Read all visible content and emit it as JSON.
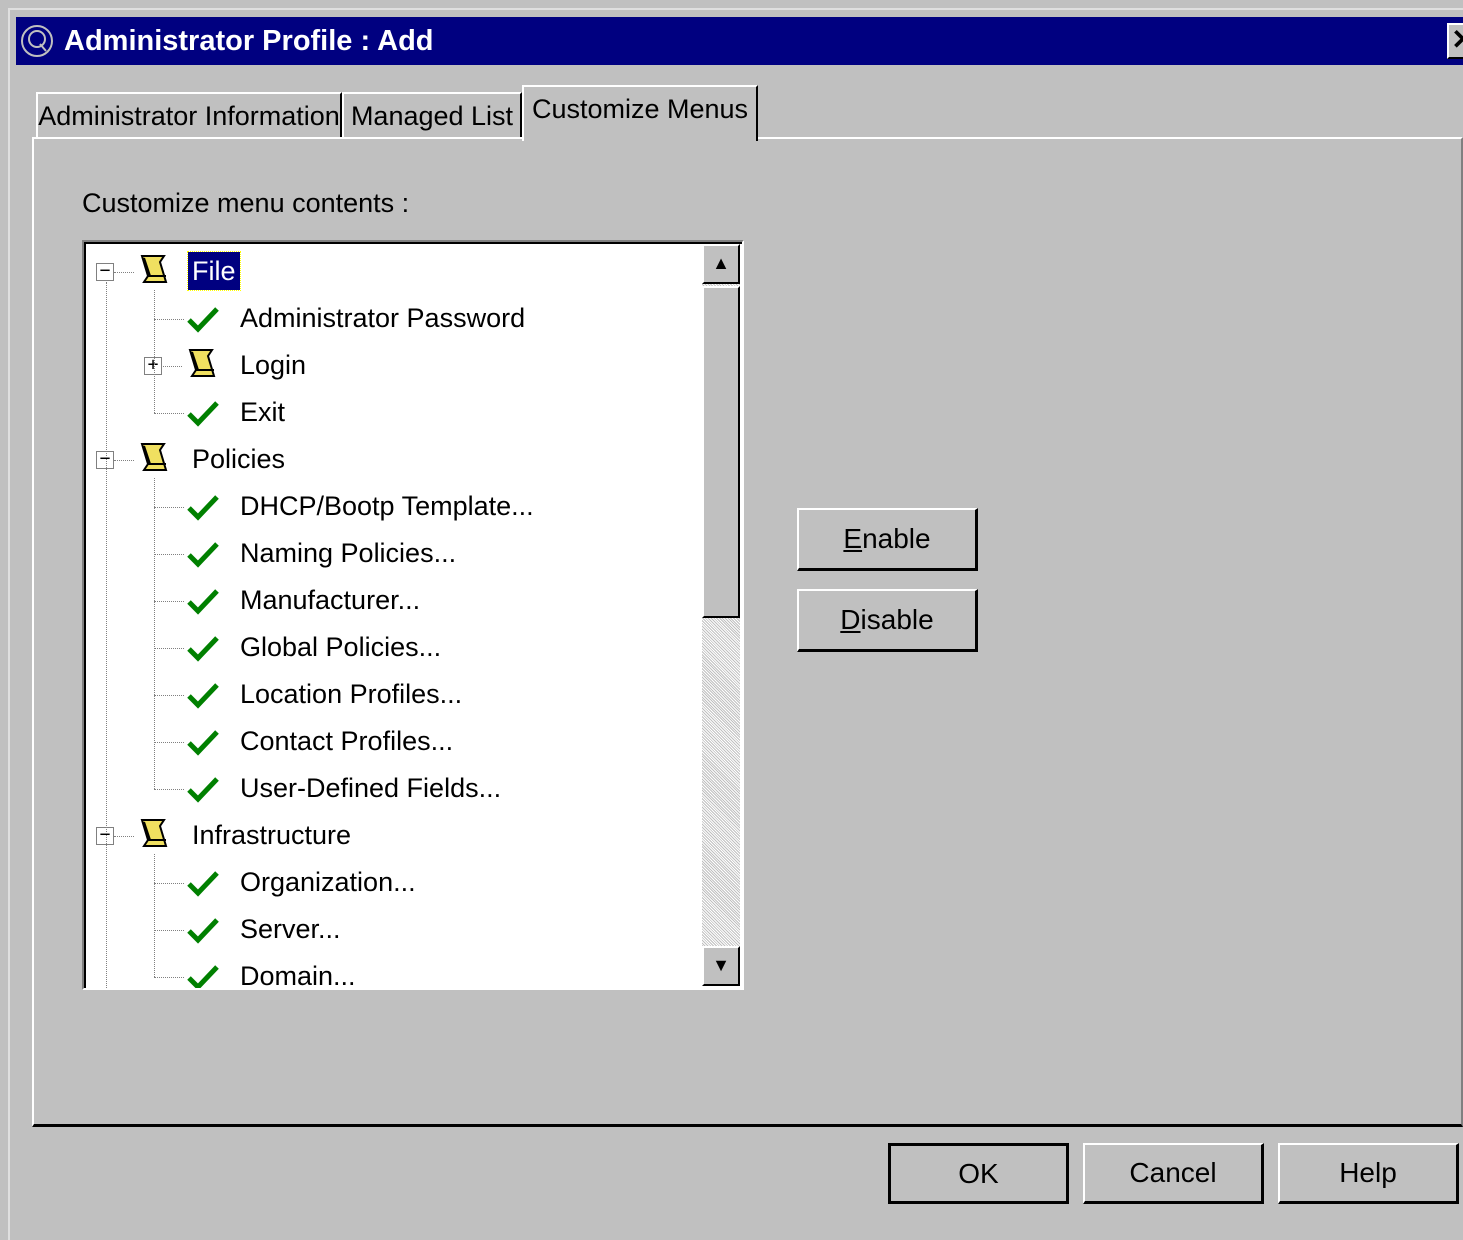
{
  "window": {
    "title": "Administrator Profile : Add",
    "close_label": "✕"
  },
  "tabs": [
    {
      "label": "Administrator Information",
      "active": false
    },
    {
      "label": "Managed List",
      "active": false
    },
    {
      "label": "Customize Menus",
      "active": true
    }
  ],
  "panel": {
    "label": "Customize menu contents :"
  },
  "tree": {
    "nodes": [
      {
        "label": "File",
        "type": "folder",
        "expanded": true,
        "selected": true
      },
      {
        "label": "Administrator Password",
        "type": "item",
        "enabled": true
      },
      {
        "label": "Login",
        "type": "folder",
        "expanded": false
      },
      {
        "label": "Exit",
        "type": "item",
        "enabled": true
      },
      {
        "label": "Policies",
        "type": "folder",
        "expanded": true
      },
      {
        "label": "DHCP/Bootp Template...",
        "type": "item",
        "enabled": true
      },
      {
        "label": "Naming Policies...",
        "type": "item",
        "enabled": true
      },
      {
        "label": "Manufacturer...",
        "type": "item",
        "enabled": true
      },
      {
        "label": "Global Policies...",
        "type": "item",
        "enabled": true
      },
      {
        "label": "Location Profiles...",
        "type": "item",
        "enabled": true
      },
      {
        "label": "Contact Profiles...",
        "type": "item",
        "enabled": true
      },
      {
        "label": "User-Defined Fields...",
        "type": "item",
        "enabled": true
      },
      {
        "label": "Infrastructure",
        "type": "folder",
        "expanded": true
      },
      {
        "label": "Organization...",
        "type": "item",
        "enabled": true
      },
      {
        "label": "Server...",
        "type": "item",
        "enabled": true
      },
      {
        "label": "Domain...",
        "type": "item",
        "enabled": true
      }
    ],
    "expand_symbol": "+",
    "collapse_symbol": "−",
    "check_color": "#008000"
  },
  "actions": {
    "enable_mnemonic": "E",
    "enable_rest": "nable",
    "disable_mnemonic": "D",
    "disable_rest": "isable"
  },
  "footer": {
    "ok_label": "OK",
    "cancel_label": "Cancel",
    "help_label": "Help"
  }
}
